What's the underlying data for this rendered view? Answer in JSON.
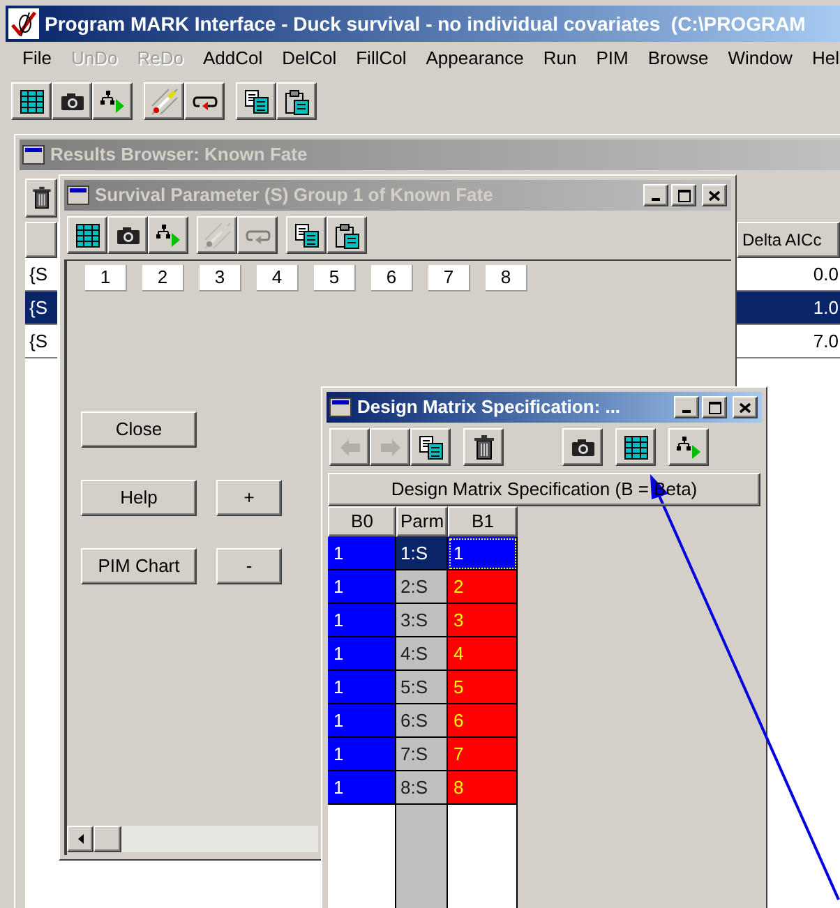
{
  "window": {
    "title": "Program MARK Interface - Duck survival - no individual covariates  (C:\\PROGRAM"
  },
  "menu": [
    {
      "label": "File",
      "disabled": false
    },
    {
      "label": "UnDo",
      "disabled": true
    },
    {
      "label": "ReDo",
      "disabled": true
    },
    {
      "label": "AddCol",
      "disabled": false
    },
    {
      "label": "DelCol",
      "disabled": false
    },
    {
      "label": "FillCol",
      "disabled": false
    },
    {
      "label": "Appearance",
      "disabled": false
    },
    {
      "label": "Run",
      "disabled": false
    },
    {
      "label": "PIM",
      "disabled": false
    },
    {
      "label": "Browse",
      "disabled": false
    },
    {
      "label": "Window",
      "disabled": false
    },
    {
      "label": "Hel",
      "disabled": false
    }
  ],
  "toolbar": [
    {
      "disabled": false
    },
    {
      "disabled": false
    },
    {
      "disabled": false
    },
    {
      "disabled": false
    },
    {
      "disabled": false
    },
    {
      "disabled": false
    },
    {
      "disabled": false
    }
  ],
  "results_browser": {
    "title": "Results Browser: Known Fate",
    "active": false,
    "column": "Delta AICc",
    "rows": [
      {
        "model": "{S",
        "delta_aicc": "0.0",
        "selected": false
      },
      {
        "model": "{S",
        "delta_aicc": "1.0",
        "selected": true
      },
      {
        "model": "{S",
        "delta_aicc": "7.0",
        "selected": false
      }
    ]
  },
  "survival_window": {
    "title": "Survival Parameter (S) Group 1 of Known Fate",
    "active": false,
    "toolbar": [
      {
        "disabled": false
      },
      {
        "disabled": false
      },
      {
        "disabled": false
      },
      {
        "disabled": true
      },
      {
        "disabled": true
      },
      {
        "disabled": false
      },
      {
        "disabled": false
      }
    ],
    "pim_labels": [
      "1",
      "2",
      "3",
      "4",
      "5",
      "6",
      "7",
      "8"
    ],
    "buttons": [
      {
        "label": "Close"
      },
      {
        "label": "Help"
      },
      {
        "label": "+"
      },
      {
        "label": "PIM Chart"
      },
      {
        "label": "-"
      }
    ]
  },
  "design_window": {
    "title": "Design Matrix Specification: ...",
    "active": true,
    "toolbar": [
      {
        "disabled": true
      },
      {
        "disabled": true
      },
      {
        "disabled": false
      },
      {
        "disabled": false
      },
      {
        "disabled": false
      },
      {
        "disabled": false
      },
      {
        "disabled": false
      }
    ],
    "header": "Design Matrix Specification (B = Beta)",
    "columns": [
      "B0",
      "Parm",
      "B1"
    ],
    "rows": [
      {
        "b0": "1",
        "parm": "1:S",
        "b1": "1",
        "selected": true
      },
      {
        "b0": "1",
        "parm": "2:S",
        "b1": "2",
        "selected": false
      },
      {
        "b0": "1",
        "parm": "3:S",
        "b1": "3",
        "selected": false
      },
      {
        "b0": "1",
        "parm": "4:S",
        "b1": "4",
        "selected": false
      },
      {
        "b0": "1",
        "parm": "5:S",
        "b1": "5",
        "selected": false
      },
      {
        "b0": "1",
        "parm": "6:S",
        "b1": "6",
        "selected": false
      },
      {
        "b0": "1",
        "parm": "7:S",
        "b1": "7",
        "selected": false
      },
      {
        "b0": "1",
        "parm": "8:S",
        "b1": "8",
        "selected": false
      }
    ]
  }
}
